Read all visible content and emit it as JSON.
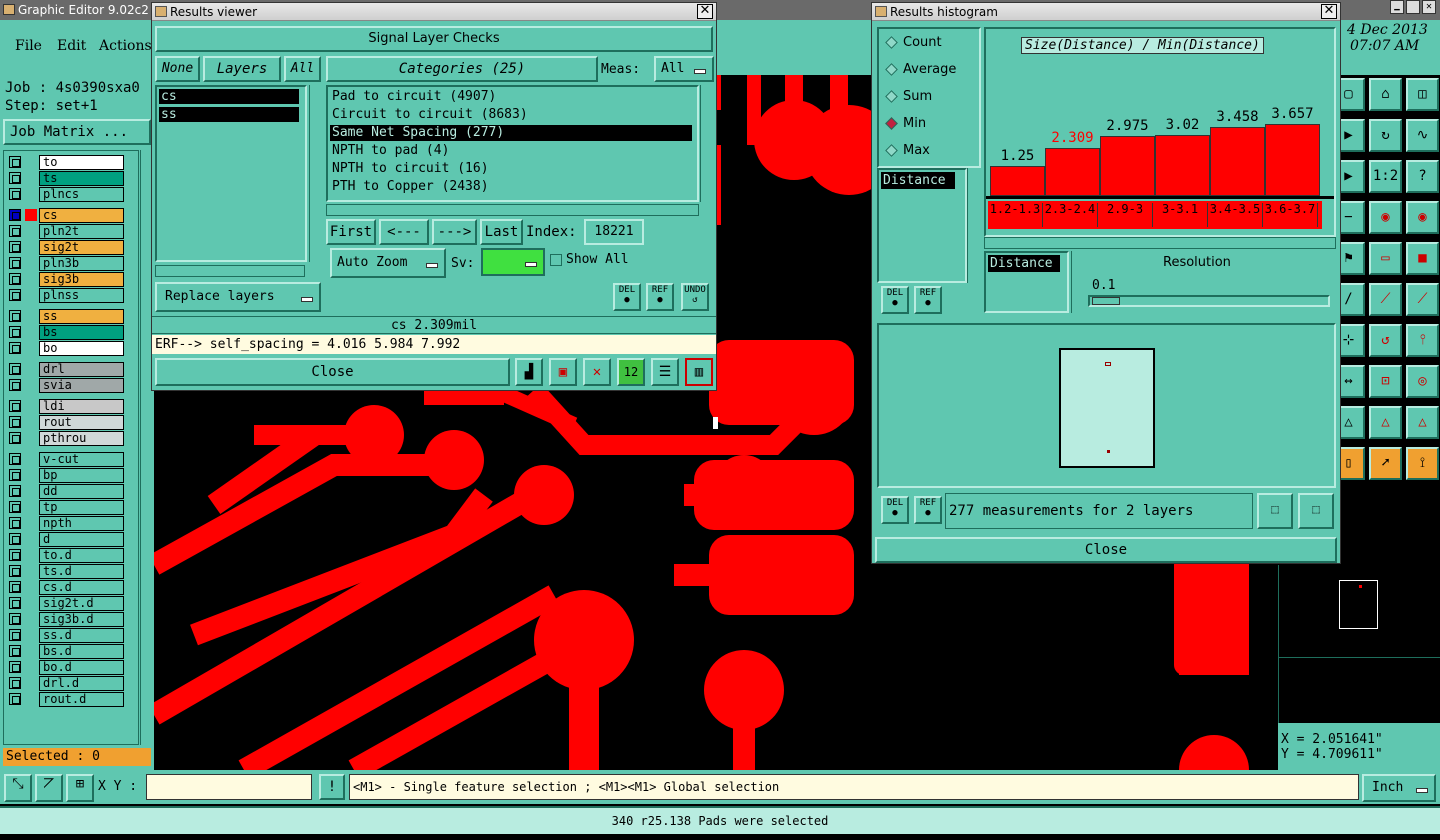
{
  "app": {
    "title": "Graphic Editor 9.02c2 (",
    "menu": [
      "File",
      "Edit",
      "Actions"
    ],
    "date": "4 Dec 2013",
    "time": "07:07 AM"
  },
  "job": {
    "job_label": "Job : 4s0390sxa0",
    "step_label": "Step: set+1",
    "matrix_button": "Job Matrix ..."
  },
  "layers": [
    {
      "name": "to",
      "color": "#ffffff",
      "sw": ""
    },
    {
      "name": "ts",
      "color": "#00a080",
      "sw": ""
    },
    {
      "name": "plncs",
      "color": "#5fc7b0",
      "sw": ""
    },
    {
      "name": "cs",
      "color": "#f0b040",
      "sw": "red",
      "sel": true
    },
    {
      "name": "pln2t",
      "color": "#5fc7b0",
      "sw": ""
    },
    {
      "name": "sig2t",
      "color": "#f0b040",
      "sw": ""
    },
    {
      "name": "pln3b",
      "color": "#5fc7b0",
      "sw": ""
    },
    {
      "name": "sig3b",
      "color": "#f0b040",
      "sw": ""
    },
    {
      "name": "plnss",
      "color": "#5fc7b0",
      "sw": ""
    },
    {
      "name": "ss",
      "color": "#f0b040",
      "sw": ""
    },
    {
      "name": "bs",
      "color": "#00a080",
      "sw": ""
    },
    {
      "name": "bo",
      "color": "#ffffff",
      "sw": ""
    },
    {
      "name": "drl",
      "color": "#a0a8a8",
      "sw": ""
    },
    {
      "name": "svia",
      "color": "#a0a8a8",
      "sw": ""
    },
    {
      "name": "ldi",
      "color": "#c8c8c8",
      "sw": ""
    },
    {
      "name": "rout",
      "color": "#d0d8d8",
      "sw": ""
    },
    {
      "name": "pthrou",
      "color": "#d0d8d8",
      "sw": ""
    },
    {
      "name": "v-cut",
      "color": "#5fc7b0",
      "sw": ""
    },
    {
      "name": "bp",
      "color": "#5fc7b0",
      "sw": ""
    },
    {
      "name": "dd",
      "color": "#5fc7b0",
      "sw": ""
    },
    {
      "name": "tp",
      "color": "#5fc7b0",
      "sw": ""
    },
    {
      "name": "npth",
      "color": "#5fc7b0",
      "sw": ""
    },
    {
      "name": "d",
      "color": "#5fc7b0",
      "sw": ""
    },
    {
      "name": "to.d",
      "color": "#5fc7b0",
      "sw": ""
    },
    {
      "name": "ts.d",
      "color": "#5fc7b0",
      "sw": ""
    },
    {
      "name": "cs.d",
      "color": "#5fc7b0",
      "sw": ""
    },
    {
      "name": "sig2t.d",
      "color": "#5fc7b0",
      "sw": ""
    },
    {
      "name": "sig3b.d",
      "color": "#5fc7b0",
      "sw": ""
    },
    {
      "name": "ss.d",
      "color": "#5fc7b0",
      "sw": ""
    },
    {
      "name": "bs.d",
      "color": "#5fc7b0",
      "sw": ""
    },
    {
      "name": "bo.d",
      "color": "#5fc7b0",
      "sw": ""
    },
    {
      "name": "drl.d",
      "color": "#5fc7b0",
      "sw": ""
    },
    {
      "name": "rout.d",
      "color": "#5fc7b0",
      "sw": ""
    }
  ],
  "selected_label": "Selected : 0",
  "results_viewer": {
    "title": "Results viewer",
    "header": "Signal Layer Checks",
    "none_btn": "None",
    "layers_btn": "Layers",
    "all_btn": "All",
    "layer_list": [
      "cs",
      "ss"
    ],
    "categories_btn": "Categories (25)",
    "meas_label": "Meas:",
    "meas_value": "All",
    "categories": [
      "Pad to circuit (4907)",
      "Circuit to circuit (8683)",
      "Same Net Spacing (277)",
      "NPTH to pad (4)",
      "NPTH to circuit (16)",
      "PTH to Copper (2438)"
    ],
    "first_btn": "First",
    "prev_btn": "<---",
    "next_btn": "--->",
    "last_btn": "Last",
    "index_label": "Index:",
    "index_value": "18221",
    "auto_zoom": "Auto Zoom",
    "sv_label": "Sv:",
    "show_all": "Show All",
    "replace_layers": "Replace layers",
    "del": "DEL",
    "ref": "REF",
    "undo": "UNDO",
    "status": "cs 2.309mil",
    "erf": "ERF--> self_spacing = 4.016 5.984 7.992",
    "close": "Close"
  },
  "histogram": {
    "title": "Results histogram",
    "options": [
      "Count",
      "Average",
      "Sum",
      "Min",
      "Max"
    ],
    "selected_option": "Min",
    "chart_title": "Size(Distance) / Min(Distance)",
    "measure_item": "Distance",
    "resolution_label": "Resolution",
    "resolution_value": "0.1",
    "distance_label": "Distance",
    "del": "DEL",
    "ref": "REF",
    "summary": "277 measurements for 2 layers",
    "close": "Close"
  },
  "chart_data": {
    "type": "bar",
    "title": "Size(Distance) / Min(Distance)",
    "categories": [
      "1.2-1.3",
      "2.3-2.4",
      "2.9-3",
      "3-3.1",
      "3.4-3.5",
      "3.6-3.7"
    ],
    "values": [
      1.25,
      2.309,
      2.975,
      3.02,
      3.458,
      3.657
    ],
    "highlight_color": "#ff0000",
    "bar_color": "#ff0000"
  },
  "bottom": {
    "xy_label": "X Y :",
    "hint": "<M1> - Single feature selection ; <M1><M1> Global selection",
    "units": "Inch",
    "status": "340 r25.138 Pads were selected",
    "coord_x": "X = 2.051641\"",
    "coord_y": "Y = 4.709611\""
  },
  "toolbar_icons": [
    "1:2",
    "?"
  ]
}
